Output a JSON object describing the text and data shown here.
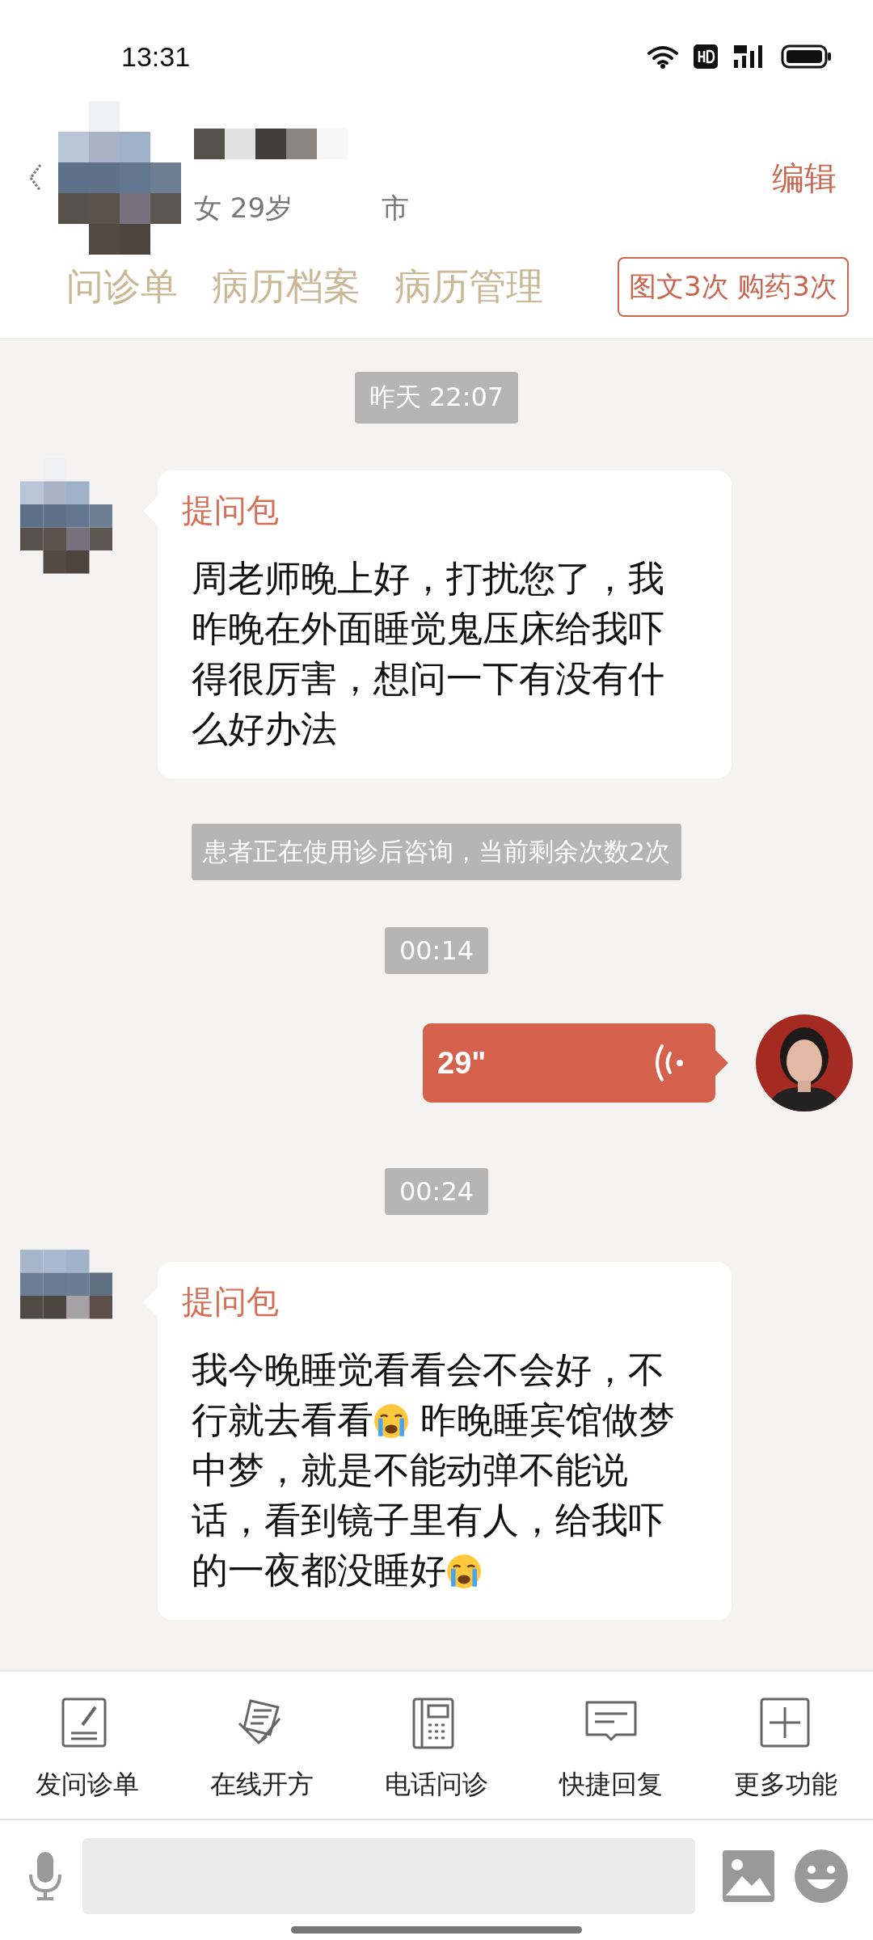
{
  "status_bar": {
    "time": "13:31"
  },
  "patient": {
    "sex_age": "女 29岁",
    "city": "市"
  },
  "header_action": "编辑",
  "tabs": [
    {
      "label": "问诊单"
    },
    {
      "label": "病历档案"
    },
    {
      "label": "病历管理"
    }
  ],
  "quota_badge": "图文3次 购药3次",
  "messages": [
    {
      "kind": "time",
      "text": "昨天 22:07"
    },
    {
      "kind": "question",
      "title": "提问包",
      "parts": [
        {
          "kind": "text",
          "text": "周老师晚上好，打扰您了，我昨晚在外面睡觉鬼压床给我吓得很厉害，想问一下有没有什么好办法"
        }
      ]
    },
    {
      "kind": "notice",
      "text": "患者正在使用诊后咨询，当前剩余次数2次"
    },
    {
      "kind": "time",
      "text": "00:14"
    },
    {
      "kind": "voice",
      "duration": "29\""
    },
    {
      "kind": "time",
      "text": "00:24"
    },
    {
      "kind": "question",
      "title": "提问包",
      "parts": [
        {
          "kind": "text",
          "text": "我今晚睡觉看看会不会好，不行就去看看"
        },
        {
          "kind": "emoji"
        },
        {
          "kind": "text",
          "text": " 昨晚睡宾馆做梦中梦，就是不能动弹不能说话，看到镜子里有人，给我吓的一夜都没睡好"
        },
        {
          "kind": "emoji"
        }
      ]
    }
  ],
  "toolbar": [
    {
      "kind": "form",
      "label": "发问诊单"
    },
    {
      "kind": "prescription",
      "label": "在线开方"
    },
    {
      "kind": "phone",
      "label": "电话问诊"
    },
    {
      "kind": "reply",
      "label": "快捷回复"
    },
    {
      "kind": "more",
      "label": "更多功能"
    }
  ]
}
